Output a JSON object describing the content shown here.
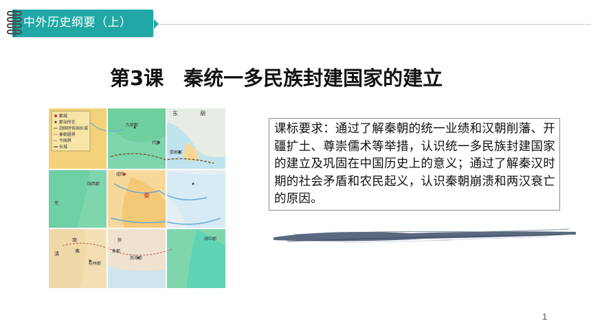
{
  "header": {
    "title": "中外历史纲要（上）"
  },
  "lesson": {
    "title": "第3课　秦统一多民族封建国家的建立"
  },
  "requirements": {
    "text": "课标要求：通过了解秦朝的统一业绩和汉朝削藩、开疆扩土、尊崇儒术等举措，认识统一多民族封建国家的建立及巩固在中国历史上的意义；通过了解秦汉时期的社会矛盾和农民起义，认识秦朝崩溃和两汉衰亡的原因。"
  },
  "map": {
    "legend": [
      "都城",
      "郡治所在",
      "战国时各国长城",
      "秦朝疆界",
      "今国界",
      "长城"
    ],
    "labels": {
      "dong": "东",
      "hu": "胡",
      "jiuyuan": "九原郡",
      "daijun": "代郡",
      "xianyang": "咸阳",
      "qin": "秦",
      "handan": "邯郸郡",
      "nanhai": "南海郡",
      "xiangjun": "象郡",
      "nan": "南",
      "yi": "夷",
      "dian": "滇",
      "qiang": "羌",
      "longxi": "陇西郡",
      "minzhong": "闽中郡",
      "guilin": "桂林郡",
      "lang": "狼"
    }
  },
  "page": {
    "number": "1"
  }
}
